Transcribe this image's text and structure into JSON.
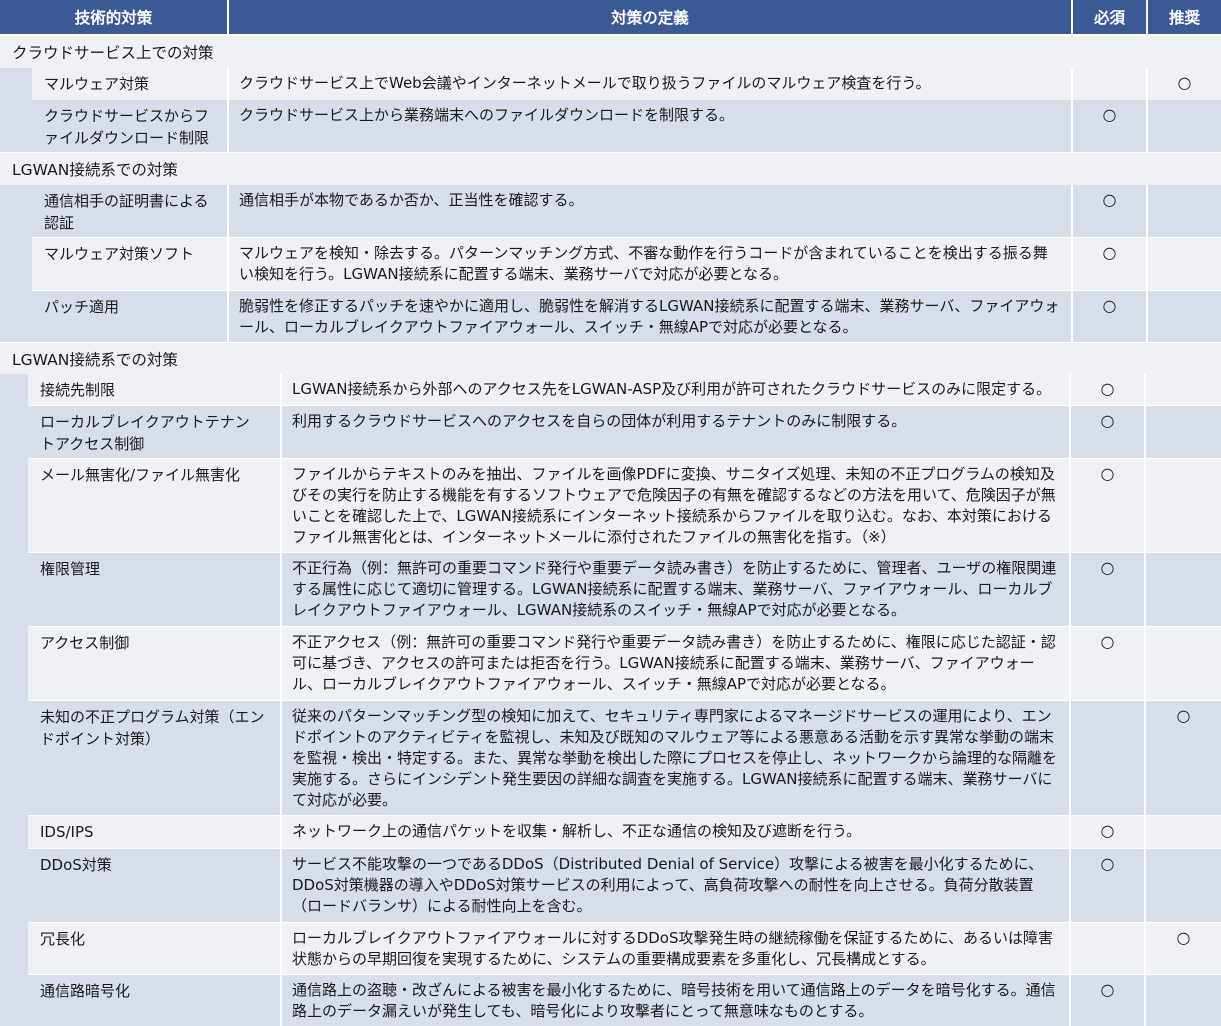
{
  "headers": {
    "technique": "技術的対策",
    "definition": "対策の定義",
    "required": "必須",
    "recommended": "推奨"
  },
  "sections": [
    {
      "title": "クラウドサービス上での対策",
      "rows": [
        {
          "name": "マルウェア対策",
          "definition": "クラウドサービス上でWeb会議やインターネットメールで取り扱うファイルのマルウェア検査を行う。",
          "required": "",
          "recommended": "○"
        },
        {
          "name": "クラウドサービスからファイルダウンロード制限",
          "definition": "クラウドサービス上から業務端末へのファイルダウンロードを制限する。",
          "required": "○",
          "recommended": ""
        }
      ]
    },
    {
      "title": "LGWAN接続系での対策",
      "rows": [
        {
          "name": "通信相手の証明書による認証",
          "definition": "通信相手が本物であるか否か、正当性を確認する。",
          "required": "○",
          "recommended": ""
        },
        {
          "name": "マルウェア対策ソフト",
          "definition": "マルウェアを検知・除去する。パターンマッチング方式、不審な動作を行うコードが含まれていることを検出する振る舞い検知を行う。LGWAN接続系に配置する端末、業務サーバで対応が必要となる。",
          "required": "○",
          "recommended": ""
        },
        {
          "name": "パッチ適用",
          "definition": "脆弱性を修正するパッチを速やかに適用し、脆弱性を解消するLGWAN接続系に配置する端末、業務サーバ、ファイアウォール、ローカルブレイクアウトファイアウォール、スイッチ・無線APで対応が必要となる。",
          "required": "○",
          "recommended": ""
        }
      ]
    },
    {
      "title": "LGWAN接続系での対策",
      "rows": [
        {
          "name": "接続先制限",
          "definition": "LGWAN接続系から外部へのアクセス先をLGWAN-ASP及び利用が許可されたクラウドサービスのみに限定する。",
          "required": "○",
          "recommended": ""
        },
        {
          "name": "ローカルブレイクアウトテナントアクセス制御",
          "definition": "利用するクラウドサービスへのアクセスを自らの団体が利用するテナントのみに制限する。",
          "required": "○",
          "recommended": ""
        },
        {
          "name": "メール無害化/ファイル無害化",
          "definition": "ファイルからテキストのみを抽出、ファイルを画像PDFに変換、サニタイズ処理、未知の不正プログラムの検知及びその実行を防止する機能を有するソフトウェアで危険因子の有無を確認するなどの方法を用いて、危険因子が無いことを確認した上で、LGWAN接続系にインターネット接続系からファイルを取り込む。なお、本対策におけるファイル無害化とは、インターネットメールに添付されたファイルの無害化を指す。（※）",
          "required": "○",
          "recommended": ""
        },
        {
          "name": "権限管理",
          "definition": "不正行為（例：無許可の重要コマンド発行や重要データ読み書き）を防止するために、管理者、ユーザの権限関連する属性に応じて適切に管理する。LGWAN接続系に配置する端末、業務サーバ、ファイアウォール、ローカルブレイクアウトファイアウォール、LGWAN接続系のスイッチ・無線APで対応が必要となる。",
          "required": "○",
          "recommended": ""
        },
        {
          "name": "アクセス制御",
          "definition": "不正アクセス（例：無許可の重要コマンド発行や重要データ読み書き）を防止するために、権限に応じた認証・認可に基づき、アクセスの許可または拒否を行う。LGWAN接続系に配置する端末、業務サーバ、ファイアウォール、ローカルブレイクアウトファイアウォール、スイッチ・無線APで対応が必要となる。",
          "required": "○",
          "recommended": ""
        },
        {
          "name": "未知の不正プログラム対策（エンドポイント対策）",
          "definition": "従来のパターンマッチング型の検知に加えて、セキュリティ専門家によるマネージドサービスの運用により、エンドポイントのアクティビティを監視し、未知及び既知のマルウェア等による悪意ある活動を示す異常な挙動の端末を監視・検出・特定する。また、異常な挙動を検出した際にプロセスを停止し、ネットワークから論理的な隔離を実施する。さらにインシデント発生要因の詳細な調査を実施する。LGWAN接続系に配置する端末、業務サーバにて対応が必要。",
          "required": "",
          "recommended": "○"
        },
        {
          "name": "IDS/IPS",
          "definition": "ネットワーク上の通信パケットを収集・解析し、不正な通信の検知及び遮断を行う。",
          "required": "○",
          "recommended": ""
        },
        {
          "name": "DDoS対策",
          "definition": "サービス不能攻撃の一つであるDDoS（Distributed Denial of Service）攻撃による被害を最小化するために、DDoS対策機器の導入やDDoS対策サービスの利用によって、高負荷攻撃への耐性を向上させる。負荷分散装置（ロードバランサ）による耐性向上を含む。",
          "required": "○",
          "recommended": ""
        },
        {
          "name": "冗長化",
          "definition": "ローカルブレイクアウトファイアウォールに対するDDoS攻撃発生時の継続稼働を保証するために、あるいは障害状態からの早期回復を実現するために、システムの重要構成要素を多重化し、冗長構成とする。",
          "required": "",
          "recommended": "○"
        },
        {
          "name": "通信路暗号化",
          "definition": "通信路上の盗聴・改ざんによる被害を最小化するために、暗号技術を用いて通信路上のデータを暗号化する。通信路上のデータ漏えいが発生しても、暗号化により攻撃者にとって無意味なものとする。",
          "required": "○",
          "recommended": ""
        }
      ]
    }
  ]
}
